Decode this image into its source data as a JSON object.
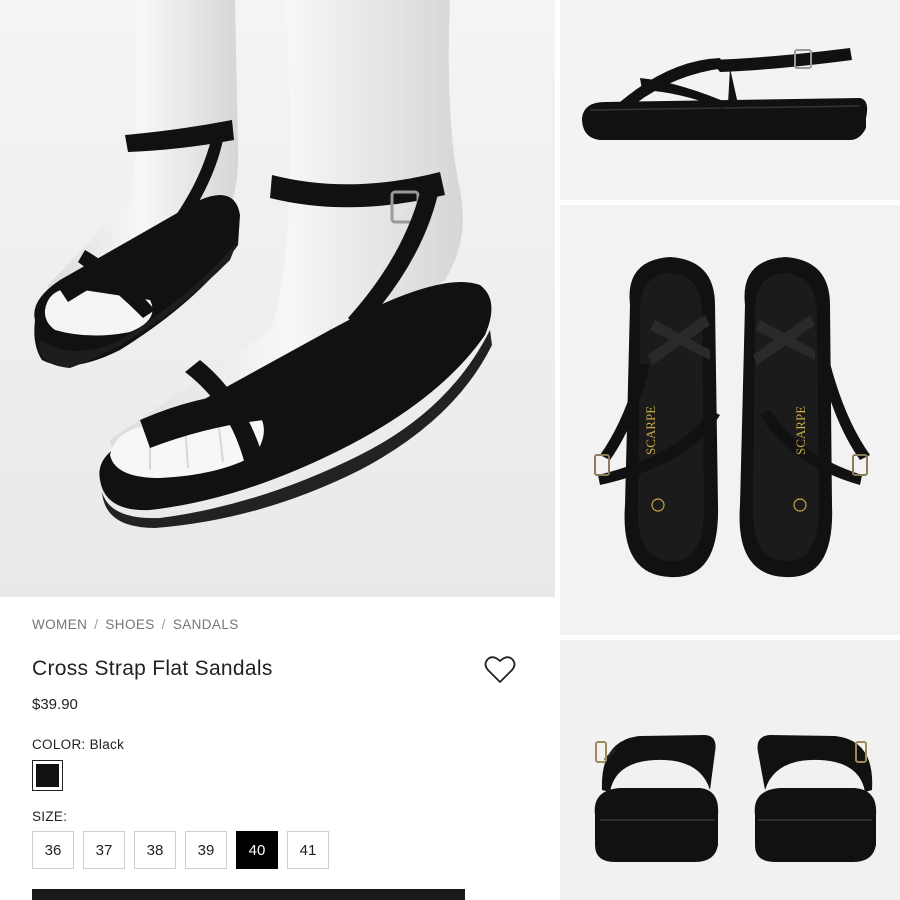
{
  "images": {
    "main_alt": "icon",
    "thumb_side": "icon",
    "thumb_top": "icon",
    "thumb_back": "icon"
  },
  "insole_brand": "SCARPE",
  "breadcrumb": [
    "WOMEN",
    "SHOES",
    "SANDALS"
  ],
  "breadcrumb_separator": "/",
  "product": {
    "title": "Cross Strap Flat Sandals",
    "price": "$39.90"
  },
  "color": {
    "label": "COLOR:",
    "value": "Black",
    "swatch_hex": "#111111"
  },
  "size": {
    "label": "SIZE:",
    "options": [
      "36",
      "37",
      "38",
      "39",
      "40",
      "41"
    ],
    "selected": "40"
  },
  "wishlist_icon": "heart-icon",
  "colors": {
    "background": "#ffffff",
    "text": "#222222",
    "muted": "#757575",
    "selected_bg": "#000000",
    "photo_bg": "#efefef"
  }
}
